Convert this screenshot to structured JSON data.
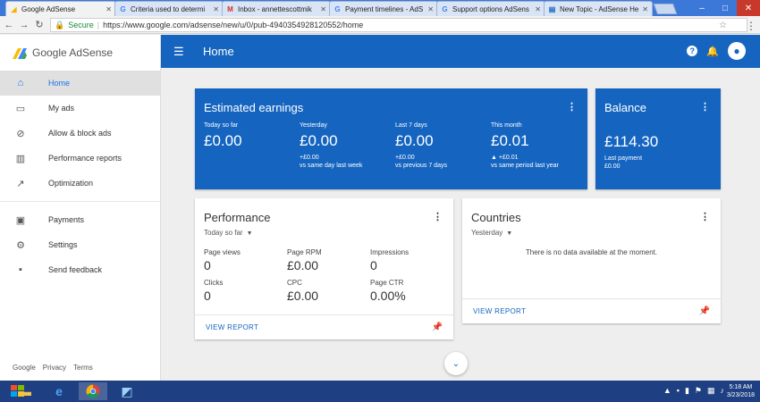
{
  "browser": {
    "tabs": [
      {
        "label": "Google AdSense",
        "fav": "adsense-icon"
      },
      {
        "label": "Criteria used to determi",
        "fav": "google-icon"
      },
      {
        "label": "Inbox - annettescottmik",
        "fav": "gmail-icon"
      },
      {
        "label": "Payment timelines - AdS",
        "fav": "google-icon"
      },
      {
        "label": "Support options AdSens",
        "fav": "google-icon"
      },
      {
        "label": "New Topic - AdSense He",
        "fav": "doc-icon"
      }
    ],
    "secure_label": "Secure",
    "url": "https://www.google.com/adsense/new/u/0/pub-4940354928120552/home"
  },
  "sidebar": {
    "brand": "Google AdSense",
    "items": [
      {
        "label": "Home",
        "icon": "home-icon"
      },
      {
        "label": "My ads",
        "icon": "ads-icon"
      },
      {
        "label": "Allow & block ads",
        "icon": "block-icon"
      },
      {
        "label": "Performance reports",
        "icon": "bar-chart-icon"
      },
      {
        "label": "Optimization",
        "icon": "trending-icon"
      },
      {
        "label": "Payments",
        "icon": "payment-icon"
      },
      {
        "label": "Settings",
        "icon": "gear-icon"
      },
      {
        "label": "Send feedback",
        "icon": "feedback-icon"
      }
    ],
    "footer": [
      "Google",
      "Privacy",
      "Terms"
    ]
  },
  "header": {
    "title": "Home",
    "help": "?"
  },
  "earnings": {
    "title": "Estimated earnings",
    "metrics": [
      {
        "label": "Today so far",
        "value": "£0.00",
        "sub1": "",
        "sub2": ""
      },
      {
        "label": "Yesterday",
        "value": "£0.00",
        "sub1": "+£0.00",
        "sub2": "vs same day last week"
      },
      {
        "label": "Last 7 days",
        "value": "£0.00",
        "sub1": "+£0.00",
        "sub2": "vs previous 7 days"
      },
      {
        "label": "This month",
        "value": "£0.01",
        "sub1": "▲ +£0.01",
        "sub2": "vs same period last year"
      }
    ]
  },
  "balance": {
    "title": "Balance",
    "value": "£114.30",
    "sub_label": "Last payment",
    "sub_value": "£0.00"
  },
  "performance": {
    "title": "Performance",
    "range": "Today so far",
    "metrics": [
      {
        "label": "Page views",
        "value": "0"
      },
      {
        "label": "Page RPM",
        "value": "£0.00"
      },
      {
        "label": "Impressions",
        "value": "0"
      },
      {
        "label": "Clicks",
        "value": "0"
      },
      {
        "label": "CPC",
        "value": "£0.00"
      },
      {
        "label": "Page CTR",
        "value": "0.00%"
      }
    ],
    "link": "VIEW REPORT"
  },
  "countries": {
    "title": "Countries",
    "range": "Yesterday",
    "empty": "There is no data available at the moment.",
    "link": "VIEW REPORT"
  },
  "taskbar": {
    "time": "5:18 AM",
    "date": "3/23/2018"
  },
  "colors": {
    "primary": "#1565c0",
    "taskbar": "#1e3f82"
  }
}
